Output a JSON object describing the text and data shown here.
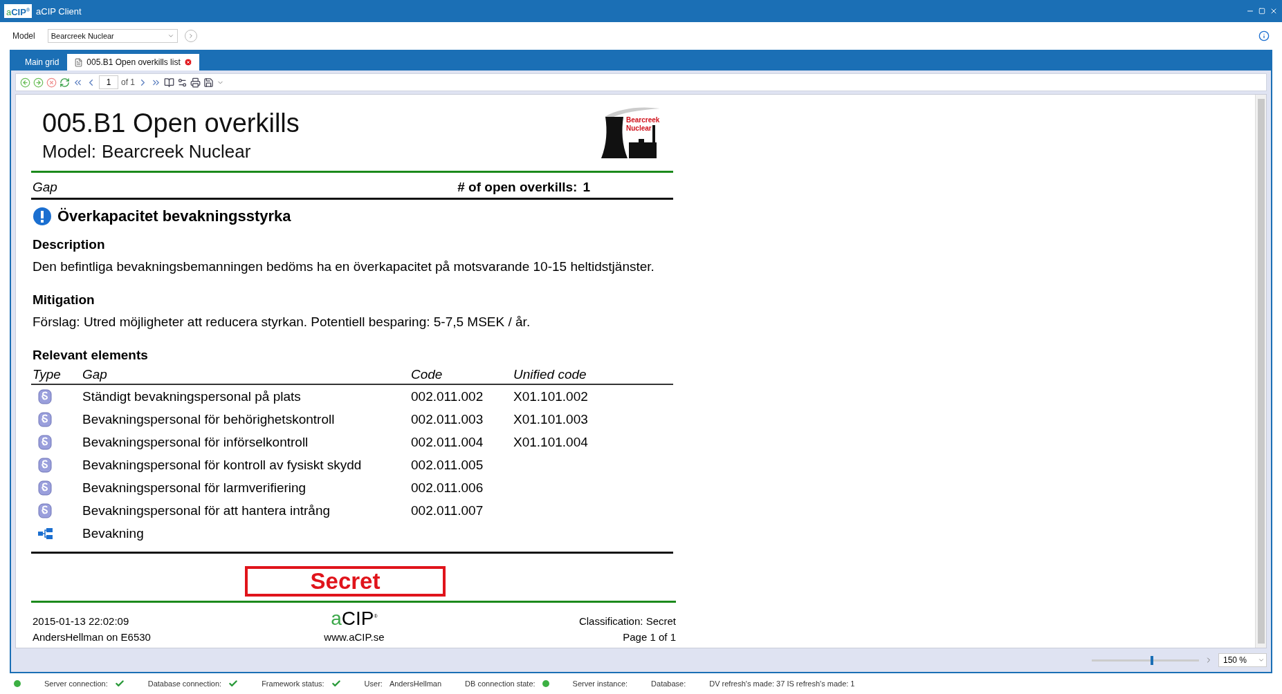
{
  "window": {
    "logo": {
      "a": "a",
      "rest": "CIP",
      "mark": "®"
    },
    "title": "aCIP Client"
  },
  "model": {
    "label": "Model",
    "value": "Bearcreek Nuclear"
  },
  "tabs": [
    {
      "label": "Main grid",
      "selected": false,
      "closable": false
    },
    {
      "label": "005.B1 Open overkills list",
      "selected": true,
      "closable": true
    }
  ],
  "toolbar": {
    "page": "1",
    "page_of": "of 1"
  },
  "report": {
    "title": "005.B1 Open overkills",
    "model_label": "Model:",
    "model_value": "Bearcreek Nuclear",
    "logo_text": [
      "Bearcreek",
      "Nuclear"
    ],
    "gap_label": "Gap",
    "count_label": "# of open overkills:",
    "count_value": "1",
    "item_title": "Överkapacitet bevakningsstyrka",
    "description_heading": "Description",
    "description": "Den befintliga bevakningsbemanningen bedöms ha en överkapacitet på motsvarande 10-15 heltidstjänster.",
    "mitigation_heading": "Mitigation",
    "mitigation": "Förslag: Utred möjligheter att reducera styrkan. Potentiell besparing: 5-7,5 MSEK / år.",
    "relevant_heading": "Relevant elements",
    "columns": [
      "Type",
      "Gap",
      "Code",
      "Unified code"
    ],
    "rows": [
      {
        "kind": "paragraph",
        "gap": "Ständigt bevakningspersonal på plats",
        "code": "002.011.002",
        "unified": "X01.101.002"
      },
      {
        "kind": "paragraph",
        "gap": "Bevakningspersonal för behörighetskontroll",
        "code": "002.011.003",
        "unified": "X01.101.003"
      },
      {
        "kind": "paragraph",
        "gap": "Bevakningspersonal för införselkontroll",
        "code": "002.011.004",
        "unified": "X01.101.004"
      },
      {
        "kind": "paragraph",
        "gap": "Bevakningspersonal för kontroll av fysiskt skydd",
        "code": "002.011.005"
      },
      {
        "kind": "paragraph",
        "gap": "Bevakningspersonal för larmverifiering",
        "code": "002.011.006"
      },
      {
        "kind": "paragraph",
        "gap": "Bevakningspersonal för att hantera intrång",
        "code": "002.011.007"
      },
      {
        "kind": "group",
        "gap": "Bevakning"
      }
    ],
    "classification_stamp": "Secret",
    "footer": {
      "timestamp": "2015-01-13 22:02:09",
      "user": "AndersHellman on E6530",
      "logo": {
        "a": "a",
        "rest": "CIP",
        "mark": "®"
      },
      "website": "www.aCIP.se",
      "classification": "Classification: Secret",
      "page": "Page 1 of 1"
    }
  },
  "zoom": {
    "level": 0.55,
    "value": "150 %"
  },
  "status_bar": [
    {
      "kind": "dot",
      "color": "#3cb043"
    },
    {
      "kind": "check",
      "label": "Server connection:"
    },
    {
      "kind": "check",
      "label": "Database connection:"
    },
    {
      "kind": "check",
      "label": "Framework status:"
    },
    {
      "kind": "value",
      "label": "User:",
      "value": "AndersHellman"
    },
    {
      "kind": "label-dot",
      "label": "DB connection state:",
      "color": "#3cb043"
    },
    {
      "kind": "label",
      "label": "Server instance:"
    },
    {
      "kind": "label",
      "label": "Database:"
    },
    {
      "kind": "label",
      "label": "DV refresh's made: 37 IS refresh's made: 1"
    }
  ]
}
